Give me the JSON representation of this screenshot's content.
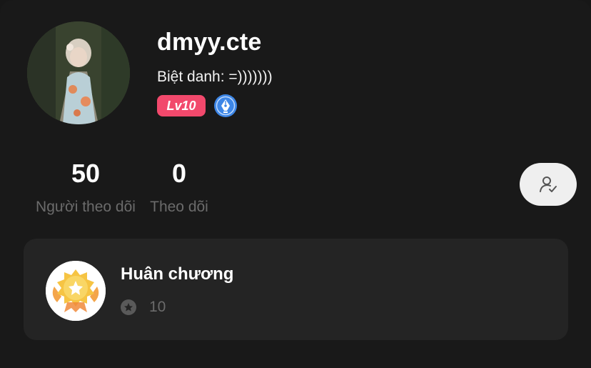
{
  "profile": {
    "username": "dmyy.cte",
    "nickname": "Biệt danh: =)))))))",
    "level": "Lv10",
    "avatar_icon": "avatar-photo",
    "verified_icon": "pen-nib-badge-icon"
  },
  "stats": {
    "followers_count": "50",
    "followers_label": "Người theo dõi",
    "following_count": "0",
    "following_label": "Theo dõi"
  },
  "actions": {
    "follow_icon": "user-check-icon"
  },
  "medals": {
    "title": "Huân chương",
    "count": "10",
    "icon": "medal-icon"
  },
  "colors": {
    "background": "#191919",
    "card": "#242424",
    "level_badge": "#f2496c",
    "badge_blue": "#3d86e6",
    "muted_text": "#6b6b6b"
  }
}
